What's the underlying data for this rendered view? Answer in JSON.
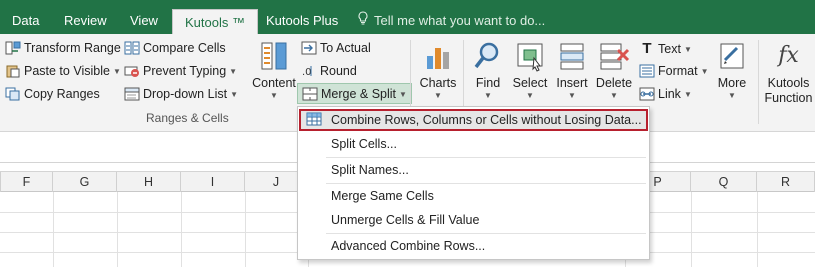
{
  "tabs": [
    {
      "label": "Data",
      "active": false
    },
    {
      "label": "Review",
      "active": false
    },
    {
      "label": "View",
      "active": false
    },
    {
      "label": "Kutools ™",
      "active": true
    },
    {
      "label": "Kutools Plus",
      "active": false
    }
  ],
  "tell_me": "Tell me what you want to do...",
  "ribbon": {
    "ranges_cells": {
      "transform_range": "Transform Range",
      "paste_to_visible": "Paste to Visible",
      "copy_ranges": "Copy Ranges",
      "compare_cells": "Compare Cells",
      "prevent_typing": "Prevent Typing",
      "dropdown_list": "Drop-down List",
      "content": "Content",
      "to_actual": "To Actual",
      "round": "Round",
      "merge_split": "Merge & Split",
      "group_label": "Ranges & Cells"
    },
    "charts": "Charts",
    "find": "Find",
    "select": "Select",
    "insert": "Insert",
    "delete": "Delete",
    "text": "Text",
    "format": "Format",
    "link": "Link",
    "more": "More",
    "kutools_functions": [
      "Kutools",
      "Function"
    ]
  },
  "columns": [
    "F",
    "G",
    "H",
    "I",
    "J",
    "P",
    "Q",
    "R"
  ],
  "menu": {
    "items": [
      {
        "label": "Combine Rows, Columns or Cells without Losing Data...",
        "highlighted": true
      },
      {
        "label": "Split Cells..."
      },
      {
        "label": "Split Names..."
      },
      {
        "label": "Merge Same Cells"
      },
      {
        "label": "Unmerge Cells & Fill Value"
      },
      {
        "label": "Advanced Combine Rows..."
      }
    ]
  },
  "colors": {
    "accent": "#217346",
    "highlight_border": "#b7202e",
    "ribbon_bg": "#f3f3f3"
  }
}
